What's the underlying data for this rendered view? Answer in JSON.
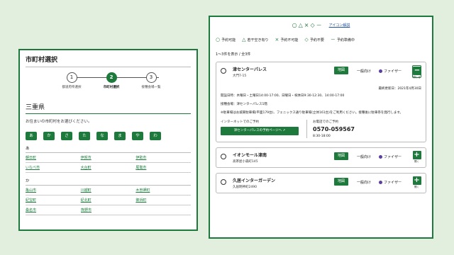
{
  "left": {
    "title": "市町村選択",
    "steps": [
      {
        "num": "1",
        "label": "都道府県選択"
      },
      {
        "num": "2",
        "label": "市町村選択"
      },
      {
        "num": "3",
        "label": "接種会場一覧"
      }
    ],
    "prefecture": "三重県",
    "prompt": "お住まいの市町村をお選びください。",
    "kana": [
      "あ",
      "か",
      "さ",
      "た",
      "な",
      "ま",
      "や",
      "わ"
    ],
    "group_a": {
      "head": "あ",
      "rows": [
        [
          "朝日町",
          "伊賀市",
          "伊勢市"
        ],
        [
          "いなべ市",
          "大台町",
          "尾鷲市"
        ]
      ]
    },
    "group_ka": {
      "head": "か",
      "rows": [
        [
          "亀山市",
          "川越町",
          "木曽岬町"
        ],
        [
          "紀宝町",
          "紀北町",
          "御浜町"
        ],
        [
          "桑名市",
          "熊野市",
          ""
        ]
      ]
    }
  },
  "right": {
    "legend_icons": "○△×◇－",
    "help_link": "アイコン解説",
    "legend": [
      {
        "sym": "○",
        "label": "予約可能"
      },
      {
        "sym": "△",
        "label": "若干空き有り"
      },
      {
        "sym": "×",
        "label": "予約不可能"
      },
      {
        "sym": "◇",
        "label": "予約不要"
      },
      {
        "sym": "－",
        "label": "予約準備中"
      }
    ],
    "count": "1～3件を表示 / 全3件",
    "map_label": "地図",
    "oneway": "一般向け",
    "vaccine": "ファイザー",
    "card1": {
      "name": "津センターパレス",
      "addr": "大門7-15",
      "close_label": "閉じる",
      "updated": "最終更新日：2021年4月30日",
      "hours_line": "開設日時：木曜日・土曜日14:00-17:00、日曜日・祝休日9:30-12:30、14:00-17:00",
      "venue_line": "接種会場：津センターパレス1階",
      "parking_line": "※駐車場はお城東駐車場(平面179台)、フェニックス通り駐車場(立体161台)をご利用ください。接種後に駐車券を発行します。",
      "net_label": "インターネットでのご予約",
      "reserve_btn": "津センターパレスの予約ページへ ↗",
      "tel_label": "お電話でのご予約",
      "phone": "0570-059567",
      "tel_hours": "8:30-18:00"
    },
    "card2": {
      "name": "イオンモール津南",
      "addr": "高茶屋小森町145",
      "open_label": "開く"
    },
    "card3": {
      "name": "久居インターガーデン",
      "addr": "久居明神町2490",
      "open_label": "開く"
    }
  }
}
